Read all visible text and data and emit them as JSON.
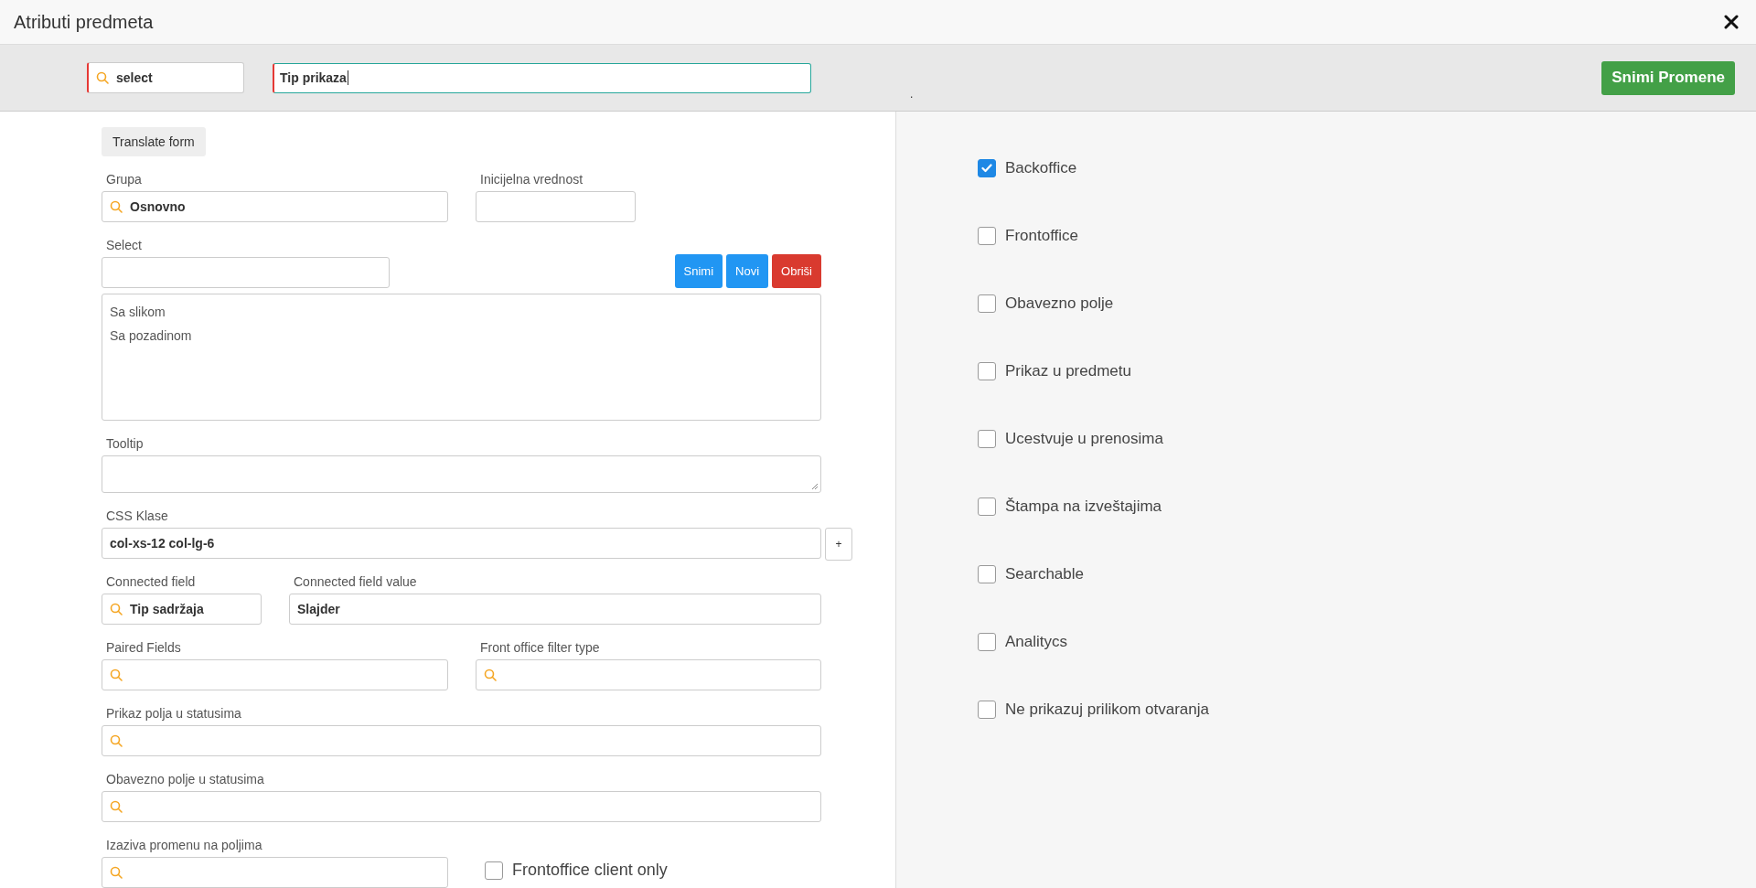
{
  "dialog": {
    "title": "Atributi predmeta"
  },
  "toolbar": {
    "search": {
      "value": "select"
    },
    "name": {
      "value": "Tip prikaza"
    },
    "dot": ".",
    "save": "Snimi Promene"
  },
  "form": {
    "translate": "Translate form",
    "grupa": {
      "label": "Grupa",
      "value": "Osnovno"
    },
    "initial": {
      "label": "Inicijelna vrednost"
    },
    "select": {
      "label": "Select"
    },
    "buttons": [
      {
        "label": "Snimi",
        "kind": "primary"
      },
      {
        "label": "Novi",
        "kind": "primary"
      },
      {
        "label": "Obriši",
        "kind": "danger"
      }
    ],
    "options": [
      {
        "label": "Sa slikom"
      },
      {
        "label": "Sa pozadinom"
      }
    ],
    "tooltip": {
      "label": "Tooltip"
    },
    "css": {
      "label": "CSS Klase",
      "value": "col-xs-12 col-lg-6",
      "add": "+"
    },
    "connected_field": {
      "label": "Connected field",
      "value": "Tip sadržaja"
    },
    "connected_value": {
      "label": "Connected field value",
      "value": "Slajder"
    },
    "paired": {
      "label": "Paired Fields"
    },
    "filter_type": {
      "label": "Front office filter type"
    },
    "status_display": {
      "label": "Prikaz polja u statusima"
    },
    "status_required": {
      "label": "Obavezno polje u statusima"
    },
    "triggers": {
      "label": "Izaziva promenu na poljima"
    },
    "client_only": {
      "label": "Frontoffice client only",
      "checked": false
    }
  },
  "flags": [
    {
      "label": "Backoffice",
      "checked": true
    },
    {
      "label": "Frontoffice",
      "checked": false
    },
    {
      "label": "Obavezno polje",
      "checked": false
    },
    {
      "label": "Prikaz u predmetu",
      "checked": false
    },
    {
      "label": "Ucestvuje u prenosima",
      "checked": false
    },
    {
      "label": "Štampa na izveštajima",
      "checked": false
    },
    {
      "label": "Searchable",
      "checked": false
    },
    {
      "label": "Analitycs",
      "checked": false
    },
    {
      "label": "Ne prikazuj prilikom otvaranja",
      "checked": false
    }
  ]
}
